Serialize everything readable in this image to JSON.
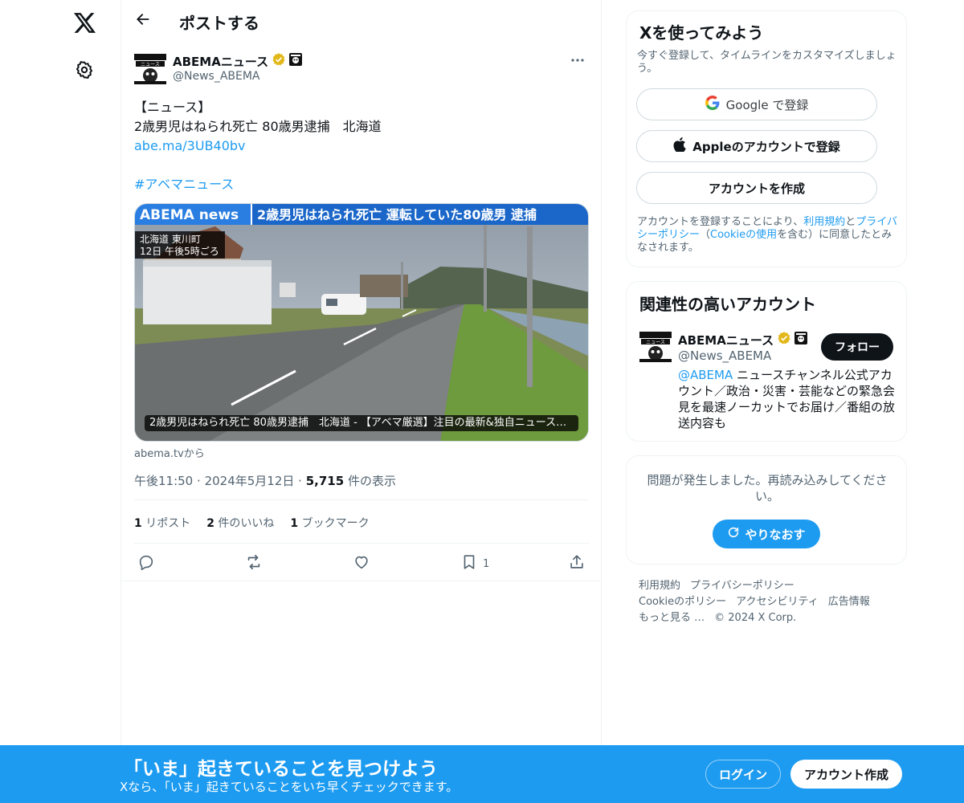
{
  "colors": {
    "accent": "#1d9bf0",
    "verified": "#e2b719",
    "text_primary": "#0f1419",
    "text_secondary": "#536471",
    "border": "#eff3f4"
  },
  "nav": {
    "logo_icon": "x-logo-icon",
    "settings_icon": "gear-icon"
  },
  "header": {
    "title": "ポストする",
    "back_icon": "arrow-left-icon"
  },
  "post": {
    "author_name": "ABEMAニュース",
    "author_handle": "@News_ABEMA",
    "avatar_label": "ニュース",
    "lines": [
      "【ニュース】",
      "2歳男児はねられ死亡 80歳男逮捕　北海道"
    ],
    "link": "abe.ma/3UB40bv",
    "hashtag": "#アベマニュース",
    "card": {
      "banner_left": "ABEMA news",
      "banner_right": "2歳男児はねられ死亡 運転していた80歳男 逮捕",
      "location_line1": "北海道 東川町",
      "location_line2": "12日 午後5時ごろ",
      "caption": "2歳男児はねられ死亡 80歳男逮捕　北海道 - 【アベマ厳選】注目の最新&独自ニュースを…"
    },
    "source": "abema.tvから",
    "time": "午後11:50",
    "date": "2024年5月12日",
    "views_count": "5,715",
    "views_label": "件の表示",
    "reposts_count": "1",
    "reposts_label": "リポスト",
    "likes_count": "2",
    "likes_label": "件のいいね",
    "bookmarks_count": "1",
    "bookmarks_label": "ブックマーク",
    "bookmark_action_count": "1"
  },
  "signup": {
    "title": "Xを使ってみよう",
    "subtitle": "今すぐ登録して、タイムラインをカスタマイズしましょう。",
    "google_label": "Google で登録",
    "apple_label": "Appleのアカウントで登録",
    "create_label": "アカウントを作成",
    "terms_prefix": "アカウントを登録することにより、",
    "terms_link1": "利用規約",
    "terms_and": "と",
    "terms_link2": "プライバシーポリシー",
    "terms_open": "（",
    "terms_link3": "Cookieの使用",
    "terms_suffix": "を含む）に同意したとみなされます。"
  },
  "related": {
    "title": "関連性の高いアカウント",
    "name": "ABEMAニュース",
    "handle": "@News_ABEMA",
    "follow_label": "フォロー",
    "bio_mention": "@ABEMA",
    "bio_text": " ニュースチャンネル公式アカウント／政治・災害・芸能などの緊急会見を最速ノーカットでお届け／番組の放送内容も"
  },
  "error_panel": {
    "message": "問題が発生しました。再読み込みしてください。",
    "retry_label": "やりなおす"
  },
  "footer": {
    "links": [
      "利用規約",
      "プライバシーポリシー",
      "Cookieのポリシー",
      "アクセシビリティ",
      "広告情報",
      "もっと見る …"
    ],
    "copyright": "© 2024 X Corp."
  },
  "bottom_bar": {
    "title": "「いま」起きていることを見つけよう",
    "subtitle": "Xなら、「いま」起きていることをいち早くチェックできます。",
    "login_label": "ログイン",
    "signup_label": "アカウント作成"
  }
}
